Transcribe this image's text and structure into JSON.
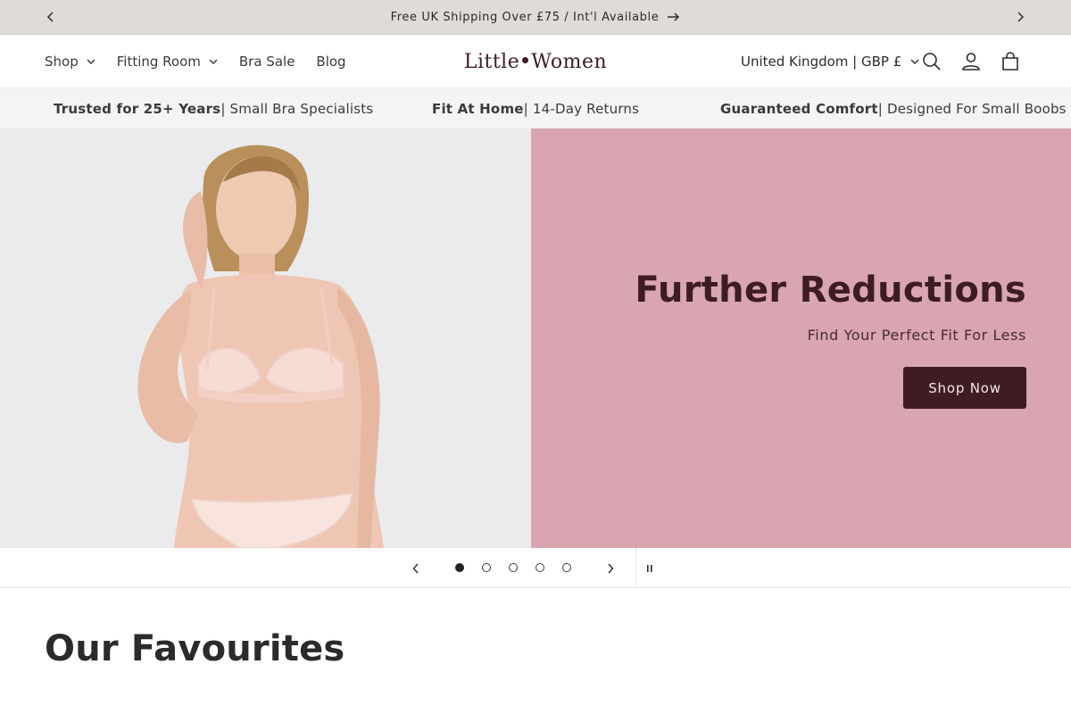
{
  "announcement": {
    "text": "Free UK Shipping Over £75 / Int'l Available",
    "prev_icon": "chevron-left-icon",
    "next_icon": "chevron-right-icon",
    "link_icon": "arrow-right-icon"
  },
  "header": {
    "nav": [
      {
        "label": "Shop",
        "has_dropdown": true
      },
      {
        "label": "Fitting Room",
        "has_dropdown": true
      },
      {
        "label": "Bra Sale",
        "has_dropdown": false
      },
      {
        "label": "Blog",
        "has_dropdown": false
      }
    ],
    "logo": {
      "left": "Little",
      "right": "Women"
    },
    "region": "United Kingdom | GBP £",
    "icons": [
      "search-icon",
      "account-icon",
      "cart-icon"
    ]
  },
  "usp": [
    {
      "bold": "Trusted for 25+ Years",
      "rest": " | Small Bra Specialists"
    },
    {
      "bold": "Fit At Home",
      "rest": " | 14-Day Returns"
    },
    {
      "bold": "Guaranteed Comfort",
      "rest": " | Designed For Small Boobs"
    }
  ],
  "hero": {
    "title": "Further Reductions",
    "subtitle": "Find Your Perfect Fit For Less",
    "button": "Shop Now",
    "panel_color": "#d8a5b1",
    "button_color": "#3f1c22"
  },
  "slideshow": {
    "slide_count": 5,
    "active_slide": 1,
    "state": "playing"
  },
  "section": {
    "title": "Our Favourites"
  },
  "colors": {
    "announcement_bg": "#dfdcd7",
    "usp_bg": "#f5f4f3",
    "brand": "#3f1c22"
  }
}
